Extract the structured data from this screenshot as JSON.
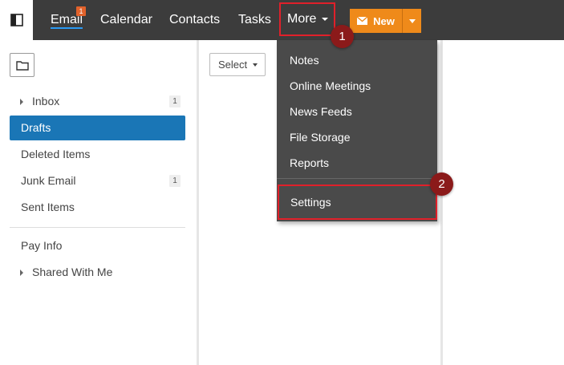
{
  "topbar": {
    "nav": [
      {
        "label": "Email",
        "badge": "1"
      },
      {
        "label": "Calendar"
      },
      {
        "label": "Contacts"
      },
      {
        "label": "Tasks"
      }
    ],
    "more_label": "More",
    "new_label": "New",
    "colors": {
      "bar": "#3c3c3c",
      "new_button": "#ef8a1a",
      "accent": "#1a76b6",
      "highlight": "#e0202a"
    }
  },
  "sidebar": {
    "folders": [
      {
        "label": "Inbox",
        "count": "1",
        "expandable": true
      },
      {
        "label": "Drafts",
        "active": true
      },
      {
        "label": "Deleted Items"
      },
      {
        "label": "Junk Email",
        "count": "1"
      },
      {
        "label": "Sent Items"
      }
    ],
    "extra": [
      {
        "label": "Pay Info"
      },
      {
        "label": "Shared With Me",
        "expandable": true
      }
    ]
  },
  "list": {
    "select_label": "Select"
  },
  "menu": {
    "items": [
      "Notes",
      "Online Meetings",
      "News Feeds",
      "File Storage",
      "Reports"
    ],
    "settings": "Settings"
  },
  "steps": [
    "1",
    "2"
  ]
}
